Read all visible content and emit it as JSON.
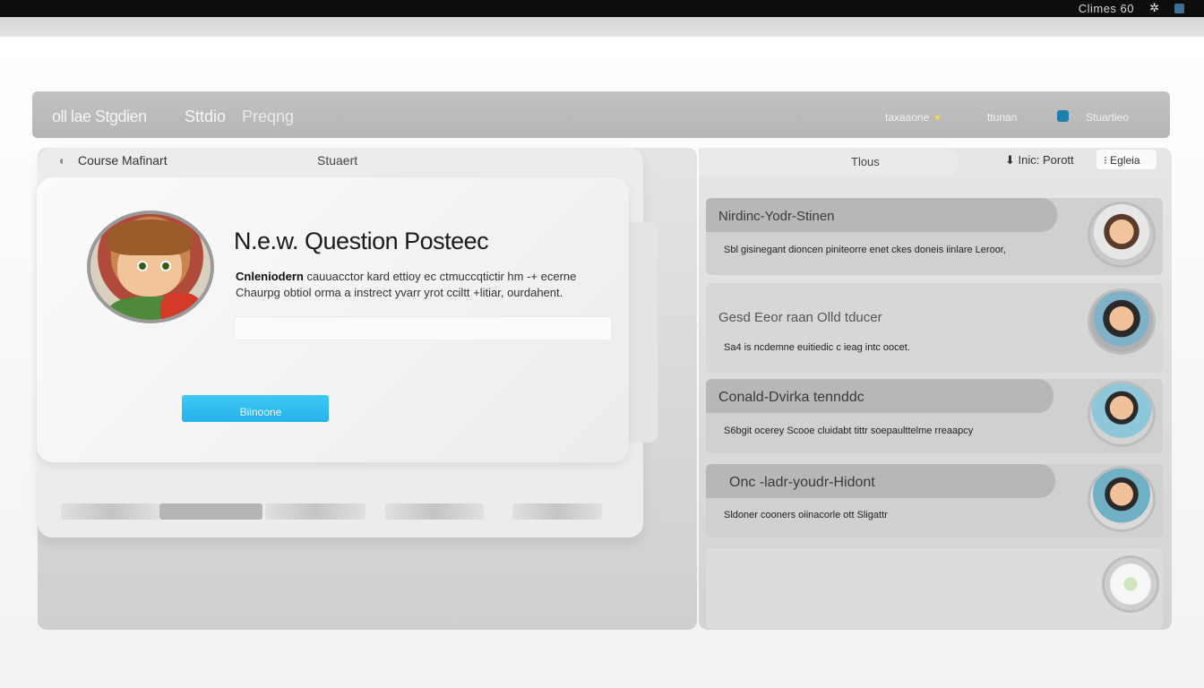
{
  "os": {
    "left_text": "",
    "time": "Climes 60",
    "icons": [
      "pinwheel-icon",
      "status-icon"
    ]
  },
  "header": {
    "brand": "oll lae Stgdien",
    "nav_studio": "Sttdio",
    "nav_pricing": "Preqng",
    "menu1": "taxaaone",
    "menu2": "ttunan",
    "menu3": "Stuartieo"
  },
  "left_panel": {
    "tab_course": "Course Mafinart",
    "tab_student": "Stuaert"
  },
  "question_card": {
    "title": "N.e.w. Question Posteec",
    "body_bold": "Cnleniodern",
    "body_line1": " cauuacctor kard ettioy ec ctmuccqtictir hm -+ ecerne",
    "body_line2": "Chaurpg obtiol orma a instrect yvarr yrot cciltt +litiar, ourdahent.",
    "input_placeholder": "",
    "button_label": "Biinoone"
  },
  "right_panel": {
    "title": "Tlous",
    "sort_label": "Inic: Porott",
    "lang_label": "Egleia",
    "items": [
      {
        "header": "Nirdinc-Yodr-Stinen",
        "text": "Sbl gisinegant dioncen piniteorre enet ckes doneis iinlare Leroor,"
      },
      {
        "header": "Gesd Eeor raan Olld tducer",
        "text": "Sa4 is ncdemne euitiedic c ieag intc oocet."
      },
      {
        "header": "Conald-Dvirka tennddc",
        "text": "S6bgit ocerey Scooe cluidabt tittr soepaulttelme rreaapcy"
      },
      {
        "header": "Onc -ladr-youdr-Hidont",
        "text": "Sldoner cooners oiinacorle ott Sligattr"
      },
      {
        "header": "",
        "text": ""
      }
    ]
  }
}
